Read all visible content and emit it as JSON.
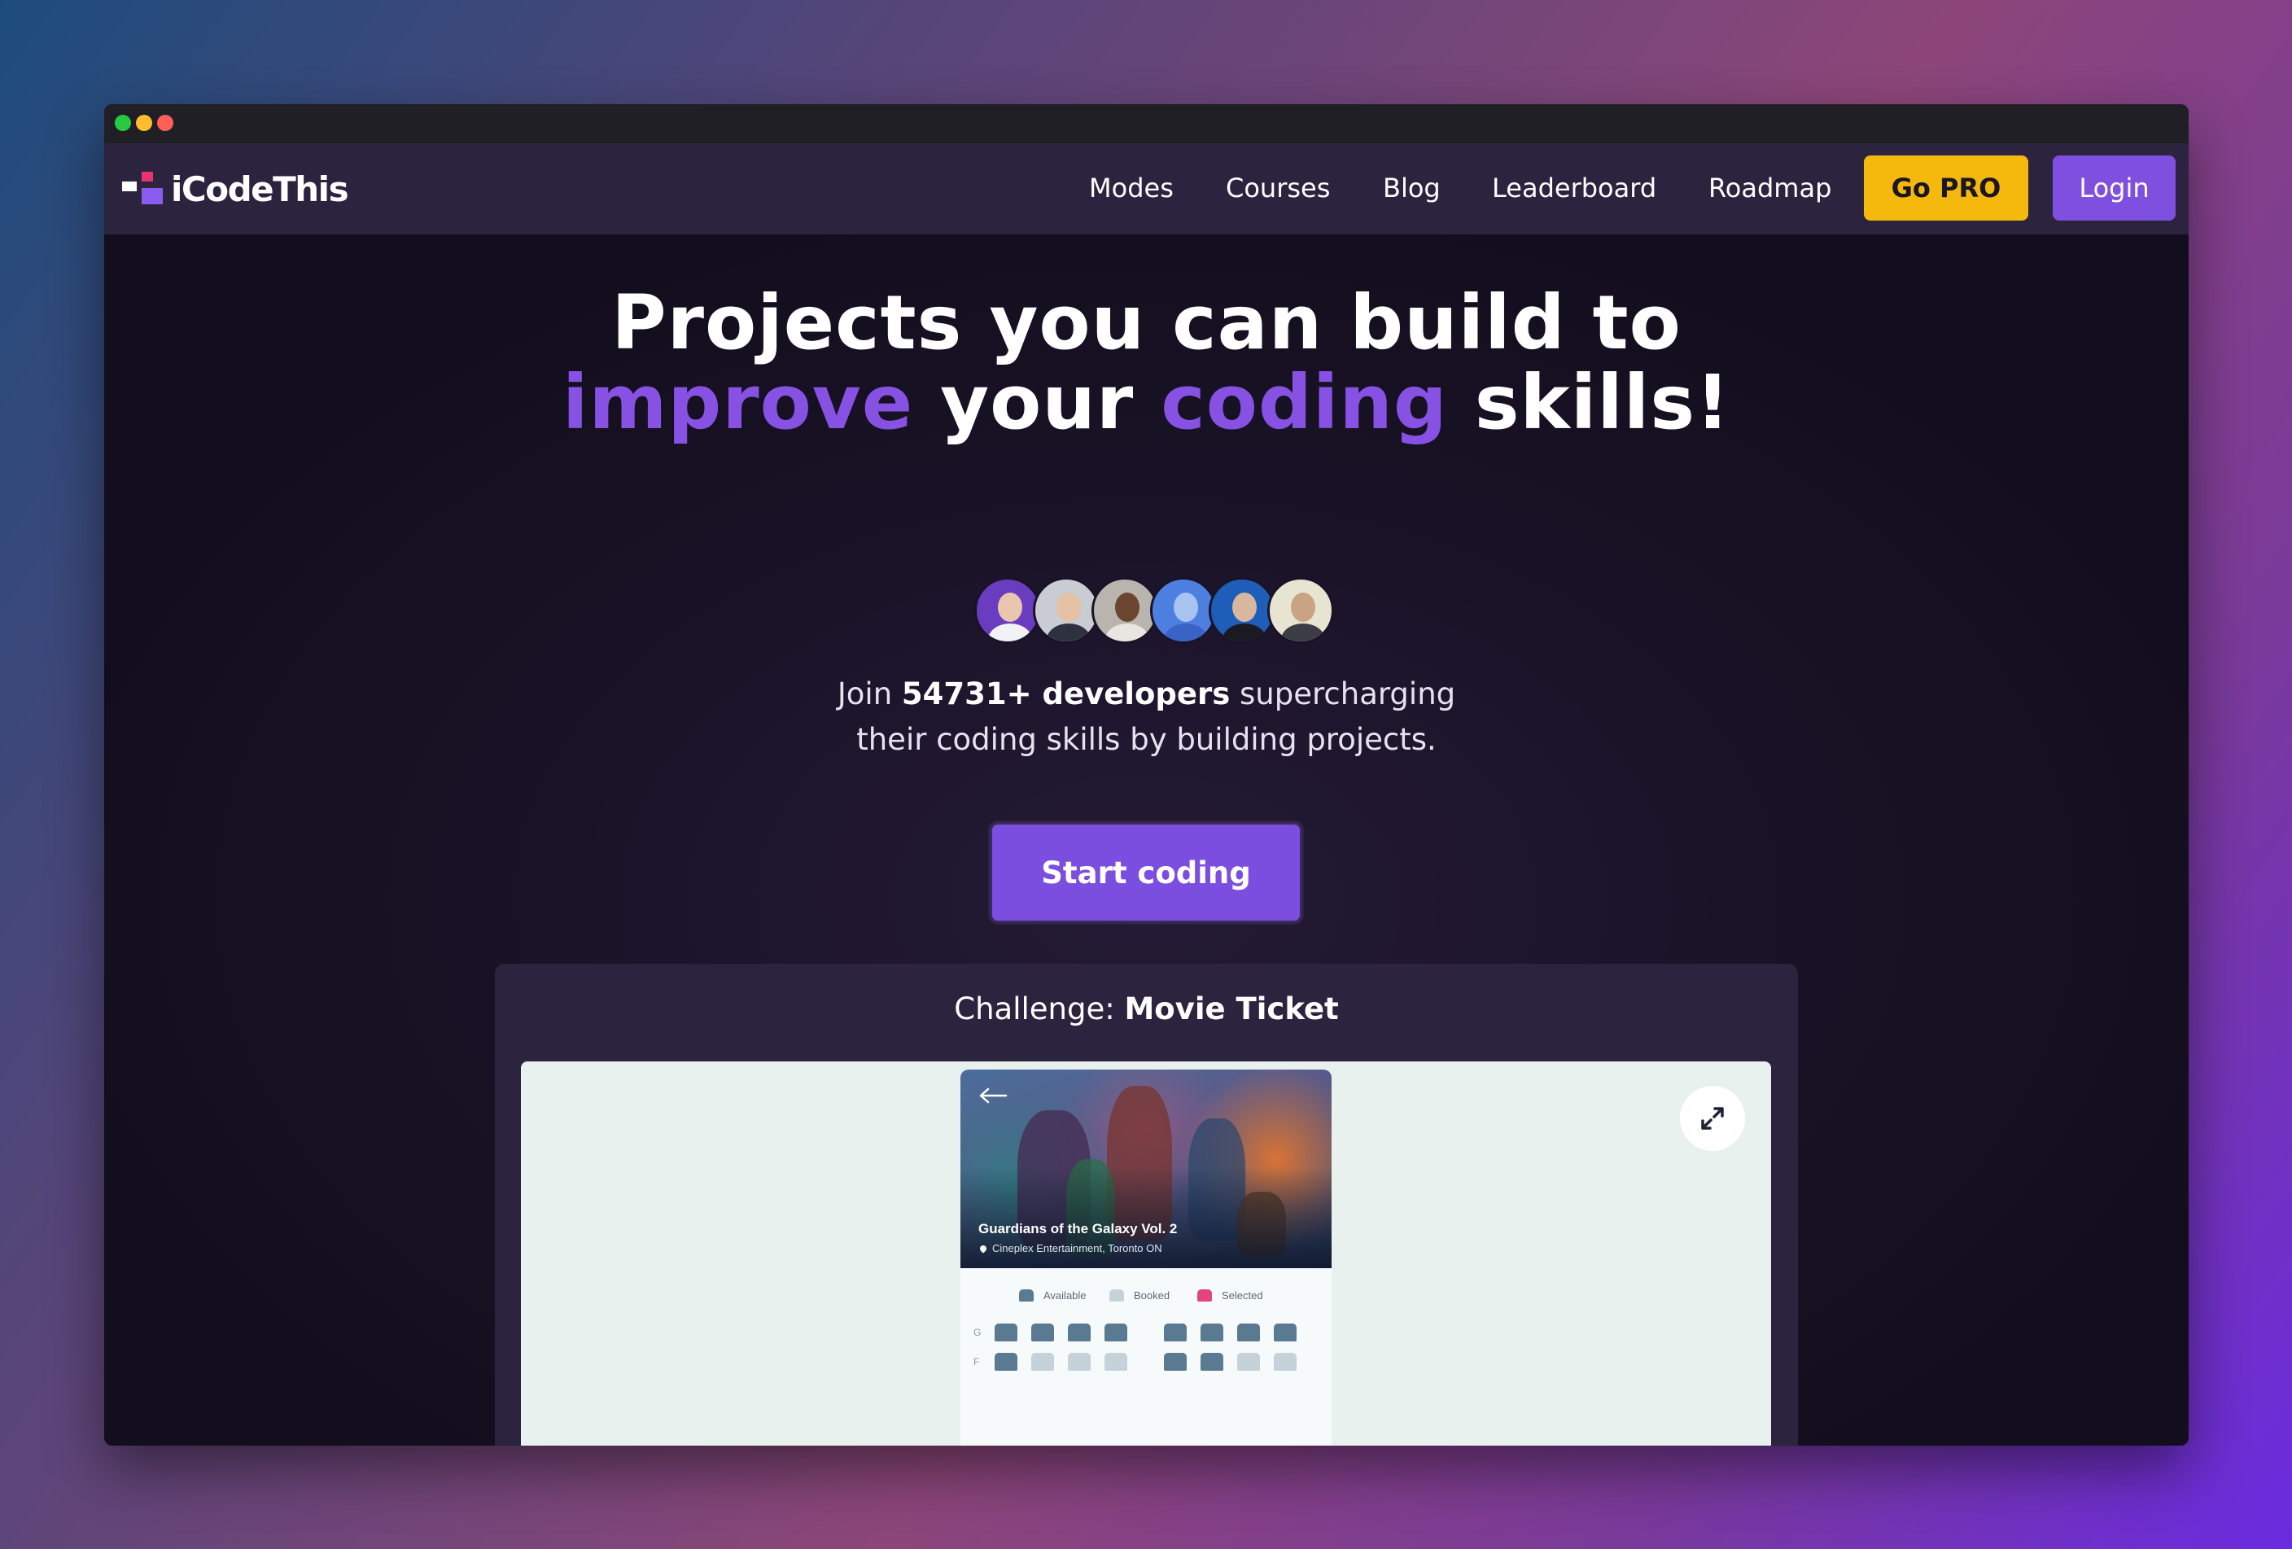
{
  "browser": {
    "controls": [
      "close",
      "minimize",
      "maximize"
    ]
  },
  "nav": {
    "logo_text": "iCodeThis",
    "links": [
      "Modes",
      "Courses",
      "Blog",
      "Leaderboard",
      "Roadmap"
    ],
    "pro_label": "Go PRO",
    "login_label": "Login"
  },
  "hero": {
    "headline_line1": "Projects you can build to",
    "headline_accent1": "improve",
    "headline_mid": " your ",
    "headline_accent2": "coding",
    "headline_end": " skills!",
    "sub_join": "Join ",
    "sub_count": "54731+ developers",
    "sub_rest1": " supercharging",
    "sub_line2": "their coding skills by building projects.",
    "cta_label": "Start coding",
    "avatar_count": 6
  },
  "challenge": {
    "prefix": "Challenge: ",
    "name": "Movie Ticket",
    "preview": {
      "movie_title": "Guardians of the Galaxy Vol. 2",
      "location": "Cineplex Entertainment, Toronto ON",
      "legend": [
        "Available",
        "Booked",
        "Selected"
      ],
      "rows": [
        {
          "label": "G",
          "seats": [
            "available",
            "available",
            "available",
            "available",
            "available",
            "available",
            "available",
            "available"
          ]
        },
        {
          "label": "F",
          "seats": [
            "available",
            "booked",
            "booked",
            "booked",
            "available",
            "available",
            "booked",
            "booked"
          ]
        }
      ]
    }
  },
  "colors": {
    "accent_purple": "#8752e4",
    "pro_yellow": "#f4b90c",
    "login_purple": "#7f4fe0",
    "seat_available": "#5a7a92",
    "seat_booked": "#c6d2da",
    "seat_selected": "#e0457b"
  },
  "icons": [
    "back-arrow-icon",
    "expand-icon",
    "location-pin-icon",
    "seat-icon"
  ]
}
